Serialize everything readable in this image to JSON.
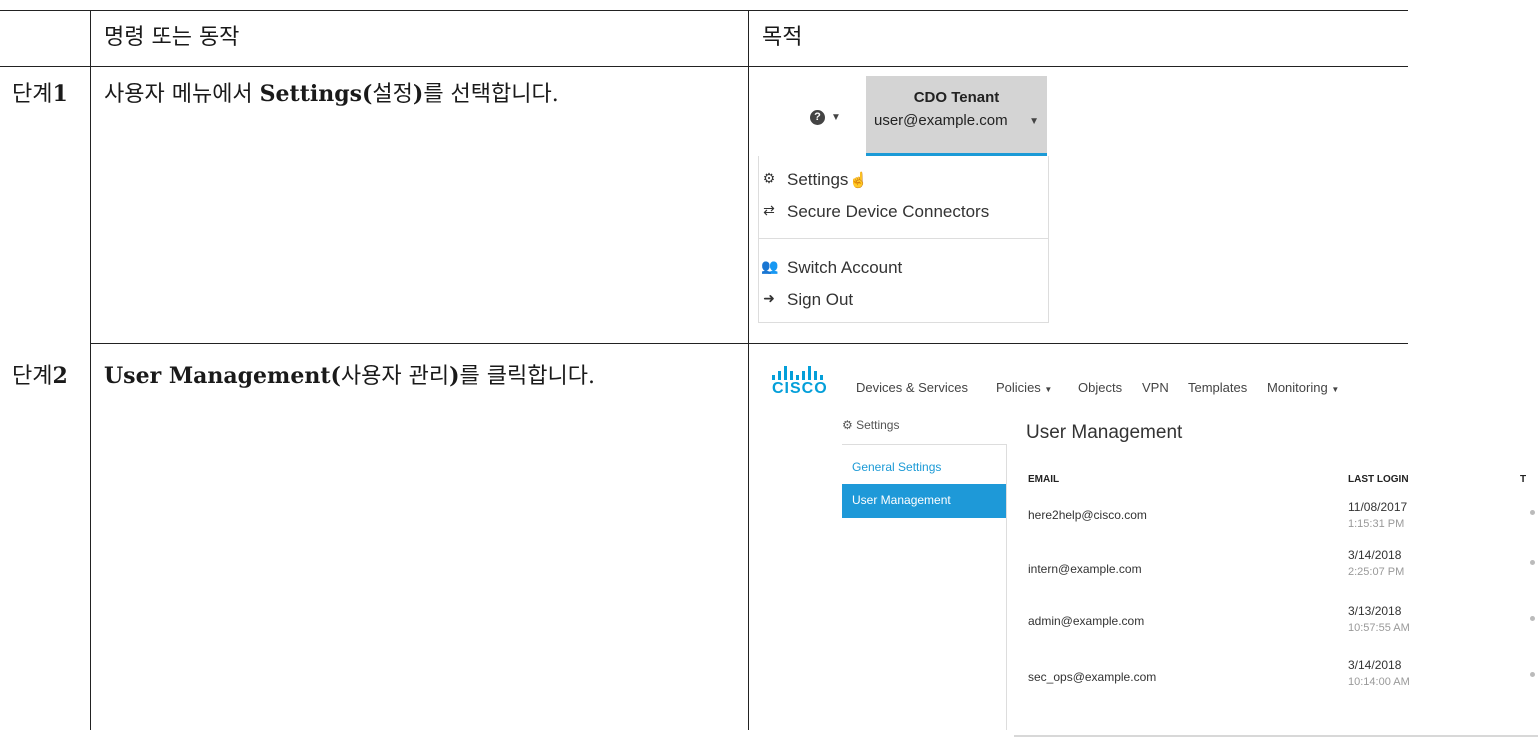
{
  "table": {
    "header_action": "명령 또는 동작",
    "header_purpose": "목적",
    "rows": [
      {
        "step_prefix": "단계",
        "step_num": "1",
        "action_bold": "Settings(",
        "action_pre": "사용자 메뉴에서 ",
        "action_mid": "설정",
        "action_bold2": ")",
        "action_post": "를 선택합니다."
      },
      {
        "step_prefix": "단계",
        "step_num": "2",
        "action_bold": "User Management(",
        "action_mid": "사용자 관리",
        "action_bold2": ")",
        "action_post": "를 클릭합니다."
      }
    ]
  },
  "shot1": {
    "help_icon": "?",
    "tenant_name": "CDO Tenant",
    "tenant_user": "user@example.com",
    "menu": [
      {
        "label": "Settings",
        "icon": "gear-icon"
      },
      {
        "label": "Secure Device Connectors",
        "icon": "arrows-exchange-icon"
      },
      {
        "label": "Switch Account",
        "icon": "users-icon"
      },
      {
        "label": "Sign Out",
        "icon": "sign-out-icon"
      }
    ]
  },
  "shot2": {
    "logo_text": "CISCO",
    "nav": [
      "Devices & Services",
      "Policies",
      "Objects",
      "VPN",
      "Templates",
      "Monitoring"
    ],
    "sidebar_header": "Settings",
    "sidebar_items": [
      "General Settings",
      "User Management"
    ],
    "page_title": "User Management",
    "columns": [
      "EMAIL",
      "LAST LOGIN",
      "T"
    ],
    "users": [
      {
        "email": "here2help@cisco.com",
        "date": "11/08/2017",
        "time": "1:15:31 PM"
      },
      {
        "email": "intern@example.com",
        "date": "3/14/2018",
        "time": "2:25:07 PM"
      },
      {
        "email": "admin@example.com",
        "date": "3/13/2018",
        "time": "10:57:55 AM"
      },
      {
        "email": "sec_ops@example.com",
        "date": "3/14/2018",
        "time": "10:14:00 AM"
      }
    ],
    "accent": "#1e99d8"
  }
}
